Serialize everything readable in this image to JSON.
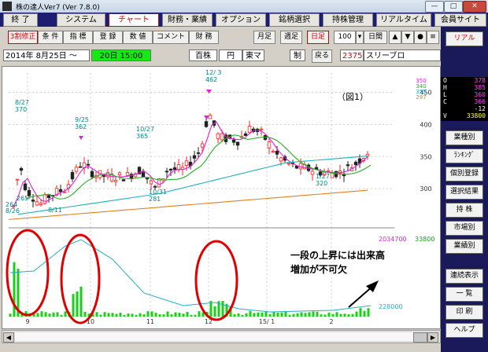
{
  "window": {
    "title": "株の達人Ver7 (Ver 7.8.0)",
    "min": "—",
    "max": "□",
    "close": "✕"
  },
  "menu": [
    "終 了",
    "システム",
    "チャート",
    "財務・業績",
    "オプション",
    "銘柄選択",
    "持株管理",
    "リアルタイム",
    "会員サイト"
  ],
  "toolbar": [
    "3割修正",
    "条 件",
    "指 標",
    "登 録",
    "数 値",
    "コメント",
    "財 務"
  ],
  "periods": {
    "monthly": "月足",
    "weekly": "週足",
    "daily": "日足"
  },
  "count": "100",
  "count_unit": "日間",
  "sidebar": [
    "リアル",
    "業種別",
    "ﾗﾝｷﾝｸﾞ",
    "個別登録",
    "選択結果",
    "持 株",
    "市場別",
    "業績別",
    "連続表示",
    "一 覧",
    "印 刷",
    "ヘルプ"
  ],
  "info": {
    "date": "2014年 8月25日 〜",
    "period": "20日 15:00",
    "unit": "百株",
    "currency": "円",
    "market": "東マ",
    "mode": "制",
    "back": "戻る",
    "code": "2375",
    "name": "スリーブロ"
  },
  "readout": [
    {
      "k": "O",
      "v": "378"
    },
    {
      "k": "H",
      "v": "385"
    },
    {
      "k": "L",
      "v": "360"
    },
    {
      "k": "C",
      "v": "366"
    },
    {
      "k": "",
      "v": "-12"
    },
    {
      "k": "V",
      "v": "33800"
    }
  ],
  "ma_legend": [
    "350",
    "340",
    "355",
    "297"
  ],
  "annotations": {
    "fig": "（図1）",
    "note_line1": "一段の上昇には出来高",
    "note_line2": "増加が不可欠"
  },
  "chart_data": {
    "type": "line",
    "xlabels": [
      "9",
      "10",
      "11",
      "12",
      "15/ 1",
      "2"
    ],
    "ylabels": [
      "450",
      "400",
      "350",
      "300"
    ],
    "volume_labels": {
      "top": "2034700",
      "top_right": "33800",
      "bottom": "228000"
    },
    "price_annotations": [
      {
        "date": "8/27",
        "value": "370"
      },
      {
        "date": "9/25",
        "value": "362"
      },
      {
        "date": "10/27",
        "value": "365"
      },
      {
        "date": "12/ 3",
        "value": "462"
      },
      {
        "date": "",
        "value": "265"
      },
      {
        "date": "",
        "value": "264"
      },
      {
        "date": "8/11",
        "value": ""
      },
      {
        "date": "8/26",
        "value": ""
      },
      {
        "date": "10/31",
        "value": "281"
      },
      {
        "date": "1/27",
        "value": "320"
      }
    ],
    "ylim": [
      250,
      480
    ]
  }
}
